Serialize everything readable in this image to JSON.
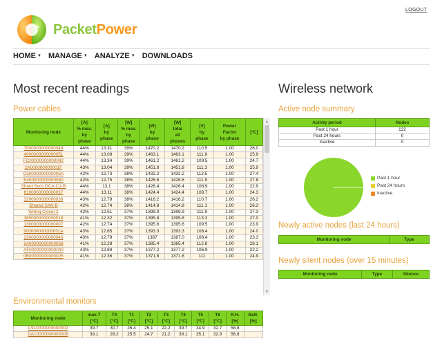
{
  "header": {
    "logout_label": "LOGOUT",
    "logo_text_part1": "Packet",
    "logo_text_part2": "Power",
    "logo_icon": "globe-logo-icon"
  },
  "nav": {
    "items": [
      {
        "label": "HOME",
        "dropdown": true
      },
      {
        "label": "MANAGE",
        "dropdown": true
      },
      {
        "label": "ANALYZE",
        "dropdown": true
      },
      {
        "label": "DOWNLOADS",
        "dropdown": false
      }
    ]
  },
  "left": {
    "title": "Most recent readings",
    "power_cables": {
      "heading": "Power cables",
      "columns": [
        "Monitoring node",
        "[A]\n% max.\nby\nphase",
        "[A]\nby\nphase",
        "[W]\n% max.\nby\nphase",
        "[W]\nby\nphase",
        "[W]\ntotal\nall\nphases",
        "[V]\nby\nphase",
        "Power\nFactor\nby phase",
        "[°C]"
      ],
      "rows": [
        [
          "7000000000000049",
          "44%",
          "13.31",
          "39%",
          "1470.2",
          "1470.2",
          "110.5",
          "1.00",
          "26.0"
        ],
        [
          "4900000000000051",
          "44%",
          "13.08",
          "39%",
          "1463.1",
          "1463.1",
          "111.9",
          "1.00",
          "25.9"
        ],
        [
          "FC00000000000042",
          "44%",
          "13.34",
          "39%",
          "1461.2",
          "1461.2",
          "109.5",
          "1.00",
          "24.7"
        ],
        [
          "2A000000000001F",
          "43%",
          "13.04",
          "39%",
          "1451.8",
          "1451.8",
          "111.3",
          "1.00",
          "25.9"
        ],
        [
          "C50000000000005A",
          "42%",
          "12.73",
          "38%",
          "1432.2",
          "1432.2",
          "112.5",
          "1.00",
          "27.4"
        ],
        [
          "E400000000000060",
          "42%",
          "12.75",
          "38%",
          "1426.6",
          "1426.6",
          "111.9",
          "1.00",
          "27.8"
        ],
        [
          "Shard Svcs DCA-C1-B",
          "44%",
          "13.1",
          "38%",
          "1426.4",
          "1426.4",
          "108.9",
          "1.00",
          "22.9"
        ],
        [
          "6100000000000037",
          "44%",
          "13.11",
          "38%",
          "1424.4",
          "1424.4",
          "108.7",
          "1.00",
          "24.3"
        ],
        [
          "3200000000000030",
          "43%",
          "12.79",
          "38%",
          "1416.2",
          "1416.2",
          "110.7",
          "1.00",
          "26.2"
        ],
        [
          "Shared SAN B",
          "42%",
          "12.74",
          "38%",
          "1414.8",
          "1414.8",
          "111.1",
          "1.00",
          "26.3"
        ],
        [
          "Wiring Closet 2",
          "42%",
          "12.51",
          "37%",
          "1399.9",
          "1399.9",
          "111.9",
          "1.00",
          "27.3"
        ],
        [
          "3800000000000018",
          "41%",
          "12.32",
          "37%",
          "1395.8",
          "1395.8",
          "113.3",
          "1.00",
          "27.0"
        ],
        [
          "1300000000000007",
          "42%",
          "12.74",
          "37%",
          "1395.6",
          "1395.6",
          "109.5",
          "1.00",
          "23.9"
        ],
        [
          "900000000000001A",
          "43%",
          "12.85",
          "37%",
          "1393.3",
          "1393.3",
          "108.4",
          "1.00",
          "24.0"
        ],
        [
          "2300000000000043",
          "43%",
          "12.79",
          "37%",
          "1387",
          "1387.0",
          "108.4",
          "1.00",
          "23.3"
        ],
        [
          "1A00000000000058",
          "41%",
          "12.28",
          "37%",
          "1385.4",
          "1385.4",
          "112.8",
          "1.00",
          "28.1"
        ],
        [
          "AF00000000000040",
          "43%",
          "12.88",
          "37%",
          "1377.2",
          "1377.2",
          "106.9",
          "1.00",
          "22.2"
        ],
        [
          "0B00000000000025",
          "41%",
          "12.36",
          "37%",
          "1371.8",
          "1371.8",
          "111",
          "1.00",
          "24.9"
        ]
      ]
    },
    "env_monitors": {
      "heading": "Environmental monitors",
      "columns": [
        "Monitoring node",
        "max.T\n[°C]",
        "T0\n[°C]",
        "T1\n[°C]",
        "T2\n[°C]",
        "T3\n[°C]",
        "T4\n[°C]",
        "T5\n[°C]",
        "T6\n[°C]",
        "R.H.\n[%]",
        "Batt.\n[%]"
      ],
      "rows": [
        [
          "C910000000000002",
          "39.7",
          "30.7",
          "26.4",
          "25.1",
          "22.2",
          "39.7",
          "34.9",
          "32.7",
          "58.8",
          ""
        ],
        [
          "DA10000000000009",
          "39.1",
          "28.2",
          "25.5",
          "24.7",
          "21.2",
          "39.1",
          "35.1",
          "32.9",
          "56.8",
          ""
        ]
      ]
    }
  },
  "right": {
    "title": "Wireless network",
    "active_summary": {
      "heading": "Active node summary",
      "columns": [
        "Activty period",
        "Nodes"
      ],
      "rows": [
        [
          "Past 1 hour",
          "122"
        ],
        [
          "Past 24 hours",
          "0"
        ],
        [
          "Inactive",
          "0"
        ]
      ]
    },
    "pie": {
      "legend": [
        {
          "label": "Past 1 hour",
          "color": "#8bd62a"
        },
        {
          "label": "Past 24 hours",
          "color": "#e3d23a"
        },
        {
          "label": "Inactive",
          "color": "#e8872a"
        }
      ],
      "values": [
        122,
        0,
        0
      ]
    },
    "newly_active": {
      "heading": "Newly active nodes (last 24 hours)",
      "columns": [
        "Monitoring node",
        "Type"
      ]
    },
    "newly_silent": {
      "heading": "Newly silent nodes (over 15 minutes)",
      "columns": [
        "Monitoring node",
        "Type",
        "Silence"
      ]
    }
  }
}
